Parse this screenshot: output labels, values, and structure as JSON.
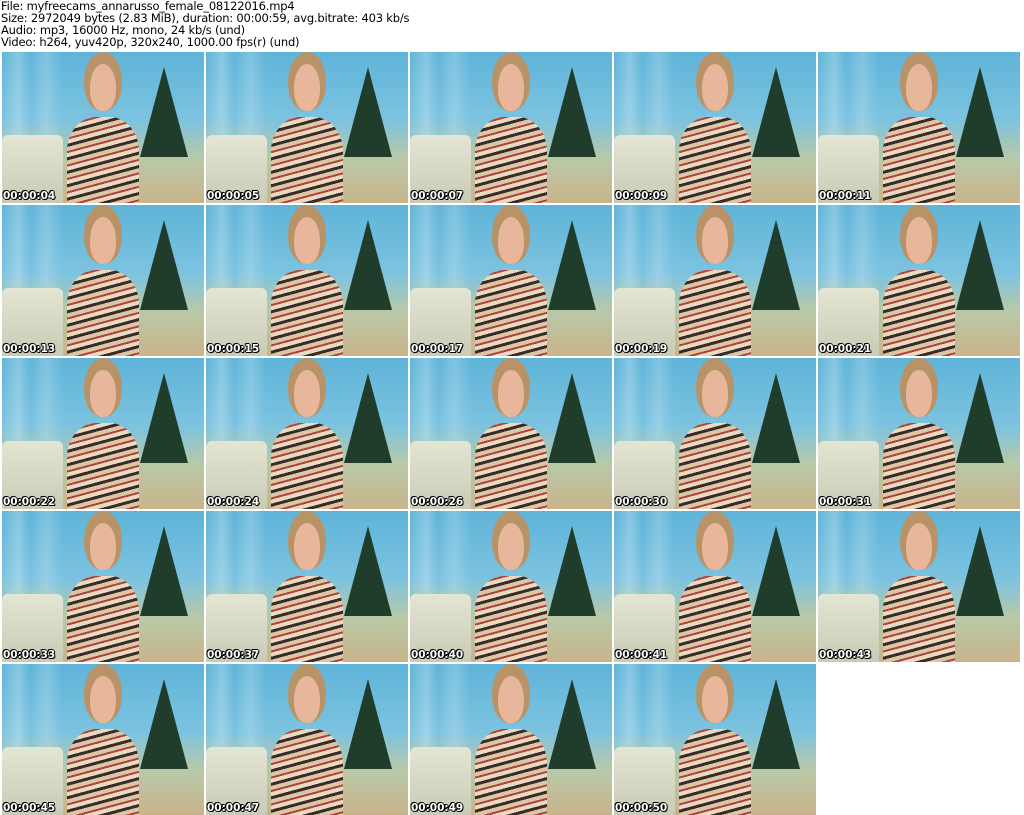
{
  "header": {
    "file": "File: myfreecams_annarusso_female_08122016.mp4",
    "size": "Size: 2972049 bytes (2.83 MiB), duration: 00:00:59, avg.bitrate: 403 kb/s",
    "audio": "Audio: mp3, 16000 Hz, mono, 24 kb/s (und)",
    "video": "Video: h264, yuv420p, 320x240, 1000.00 fps(r) (und)"
  },
  "frames": [
    "00:00:04",
    "00:00:05",
    "00:00:07",
    "00:00:09",
    "00:00:11",
    "00:00:13",
    "00:00:15",
    "00:00:17",
    "00:00:19",
    "00:00:21",
    "00:00:22",
    "00:00:24",
    "00:00:26",
    "00:00:30",
    "00:00:31",
    "00:00:33",
    "00:00:37",
    "00:00:40",
    "00:00:41",
    "00:00:43",
    "00:00:45",
    "00:00:47",
    "00:00:49",
    "00:00:50"
  ]
}
